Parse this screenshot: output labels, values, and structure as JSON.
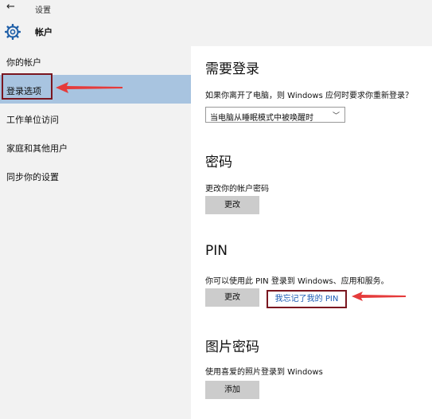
{
  "window": {
    "title": "设置",
    "section": "帐户"
  },
  "sidebar": {
    "items": [
      {
        "label": "你的帐户"
      },
      {
        "label": "登录选项"
      },
      {
        "label": "工作单位访问"
      },
      {
        "label": "家庭和其他用户"
      },
      {
        "label": "同步你的设置"
      }
    ]
  },
  "signin_required": {
    "heading": "需要登录",
    "description": "如果你离开了电脑，则 Windows 应何时要求你重新登录？",
    "dropdown_value": "当电脑从睡眠模式中被唤醒时"
  },
  "password": {
    "heading": "密码",
    "description": "更改你的帐户密码",
    "button": "更改"
  },
  "pin": {
    "heading": "PIN",
    "description": "你可以使用此 PIN 登录到 Windows、应用和服务。",
    "button": "更改",
    "forgot_link": "我忘记了我的 PIN"
  },
  "picture_password": {
    "heading": "图片密码",
    "description": "使用喜爱的照片登录到 Windows",
    "button": "添加"
  },
  "colors": {
    "annotation": "#e53b3b",
    "highlight_box": "#7a1620",
    "selected_nav": "#a8c4e0",
    "link": "#1a5ab4"
  }
}
